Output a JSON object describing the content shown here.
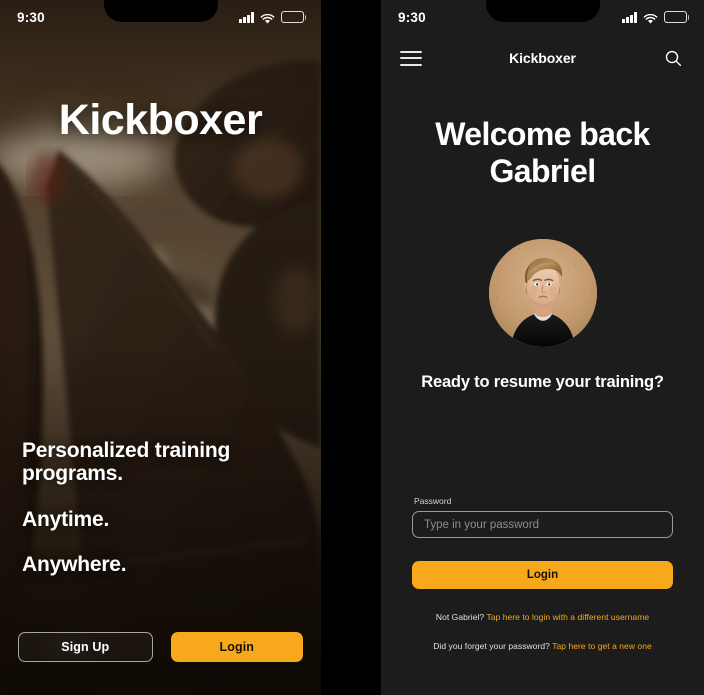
{
  "theme": {
    "accent": "#F7A81B",
    "panel_bg": "#1c1c1c",
    "gutter": "#000000",
    "text": "#ffffff",
    "muted": "#8d8d8d"
  },
  "left_phone": {
    "status_bar": {
      "time": "9:30",
      "signal_icon": "signal-bars-icon",
      "wifi_icon": "wifi-icon",
      "battery_icon": "battery-icon"
    },
    "brand_title": "Kickboxer",
    "hero_image_alt": "kickboxer training in a dark gym",
    "taglines": [
      "Personalized training programs.",
      "Anytime.",
      "Anywhere."
    ],
    "buttons": {
      "signup_label": "Sign Up",
      "login_label": "Login"
    }
  },
  "right_phone": {
    "status_bar": {
      "time": "9:30",
      "signal_icon": "signal-bars-icon",
      "wifi_icon": "wifi-icon",
      "battery_icon": "battery-icon"
    },
    "appbar": {
      "menu_icon": "hamburger-menu-icon",
      "title": "Kickboxer",
      "search_icon": "search-icon"
    },
    "welcome_line1": "Welcome back",
    "welcome_line2": "Gabriel",
    "avatar_alt": "profile photo of Gabriel",
    "prompt": "Ready to resume your training?",
    "password_field": {
      "label": "Password",
      "placeholder": "Type in your password",
      "value": ""
    },
    "login_button_label": "Login",
    "links": {
      "row1_prefix": "Not Gabriel?",
      "row1_link": "Tap here to login with a different username",
      "row2_prefix": "Did you forget your password?",
      "row2_link": "Tap here to get a new one"
    }
  }
}
